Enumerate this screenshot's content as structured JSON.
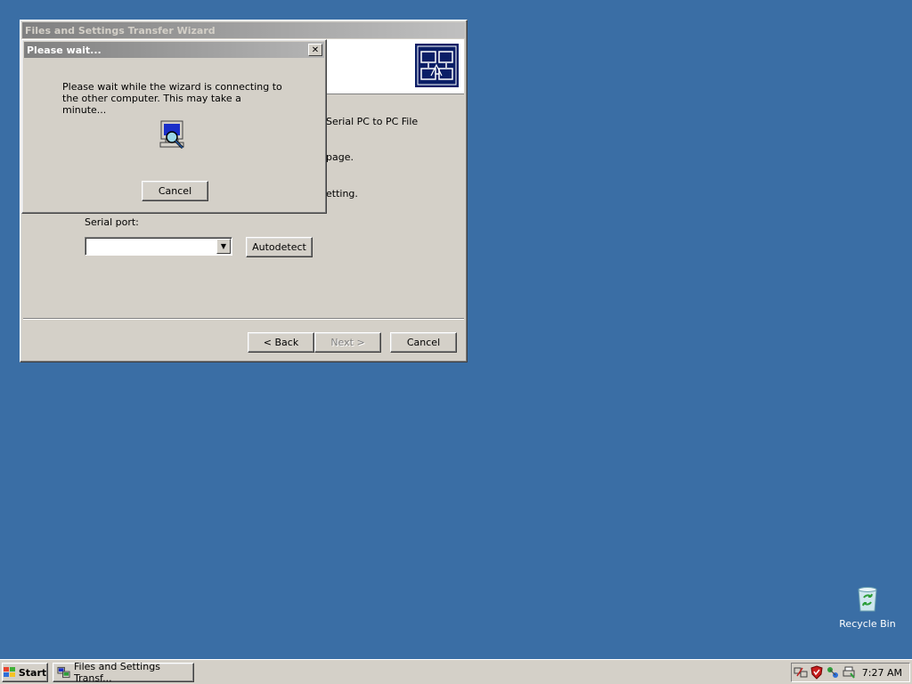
{
  "wizard": {
    "title": "Files and Settings Transfer Wizard",
    "text_line1": "Serial PC to PC File",
    "text_line2": "page.",
    "text_line3": "etting.",
    "serial_label": "Serial port:",
    "serial_value": "",
    "autodetect_label": "Autodetect",
    "back_label": "< Back",
    "next_label": "Next >",
    "cancel_label": "Cancel"
  },
  "wait_dialog": {
    "title": "Please wait...",
    "message": "Please wait while the wizard is connecting to the other computer. This may take a minute...",
    "close_glyph": "✕",
    "cancel_label": "Cancel"
  },
  "desktop": {
    "recycle_bin_label": "Recycle Bin",
    "background_color": "#3a6ea5"
  },
  "taskbar": {
    "start_label": "Start",
    "task_label": "Files and Settings Transf...",
    "clock": "7:27 AM",
    "tray_icons": [
      "network-icon",
      "shield-icon",
      "connection-icon",
      "printer-icon"
    ]
  }
}
